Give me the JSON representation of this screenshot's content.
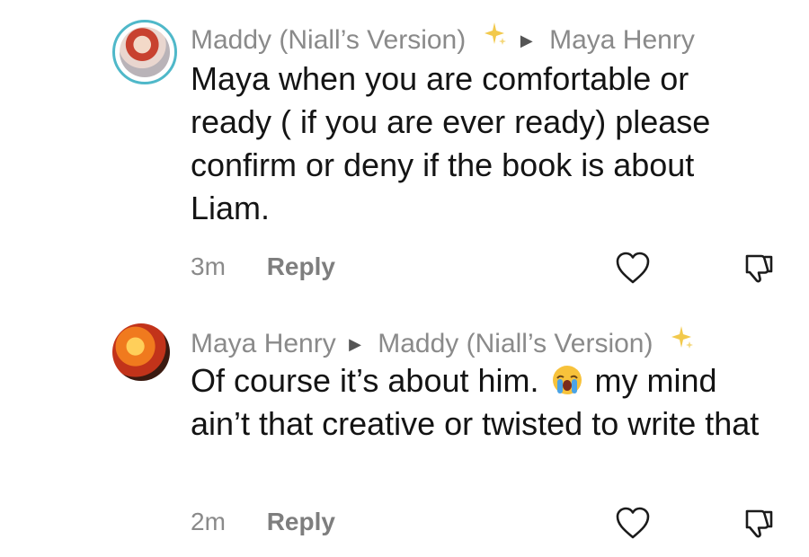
{
  "comments": [
    {
      "author": "Maddy (Niall’s Version)",
      "reply_to": "Maya Henry",
      "text": "Maya when you are comfortable or ready ( if you are ever ready) please confirm or deny if the book is about Liam.",
      "time": "3m",
      "reply_label": "Reply"
    },
    {
      "author": "Maya Henry",
      "reply_to": "Maddy (Niall’s Version)",
      "text_before_emoji": "Of course it’s about him.",
      "emoji": "loudly-crying-face",
      "text_after_emoji": "my mind ain’t that creative or twisted to write that",
      "time": "2m",
      "reply_label": "Reply"
    }
  ],
  "icons": {
    "sparkle": "sparkle-icon",
    "arrow": "play-arrow-icon",
    "like": "heart-outline-icon",
    "dislike": "thumbs-down-outline-icon"
  },
  "colors": {
    "meta_gray": "#8a8a8a",
    "text": "#141414",
    "avatar_ring": "#4fb8c9",
    "sparkle": "#f2c94c"
  }
}
